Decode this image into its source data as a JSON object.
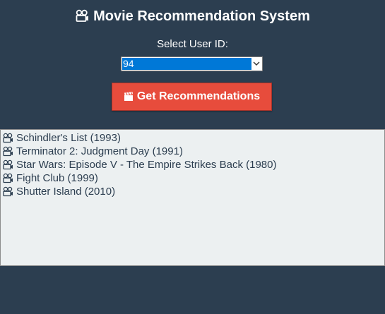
{
  "header": {
    "title": "Movie Recommendation System",
    "icon": "film-projector-icon"
  },
  "user_select": {
    "label": "Select User ID:",
    "selected_value": "94"
  },
  "action": {
    "button_label": "Get Recommendations",
    "button_icon": "clapperboard-icon"
  },
  "results": {
    "item_icon": "film-projector-icon",
    "items": [
      "Schindler's List (1993)",
      "Terminator 2: Judgment Day (1991)",
      "Star Wars: Episode V - The Empire Strikes Back (1980)",
      "Fight Club (1999)",
      "Shutter Island (2010)"
    ]
  },
  "colors": {
    "background": "#2c3e50",
    "button": "#e74c3c",
    "results_bg": "#ecf0f1",
    "selection": "#0078d7"
  }
}
